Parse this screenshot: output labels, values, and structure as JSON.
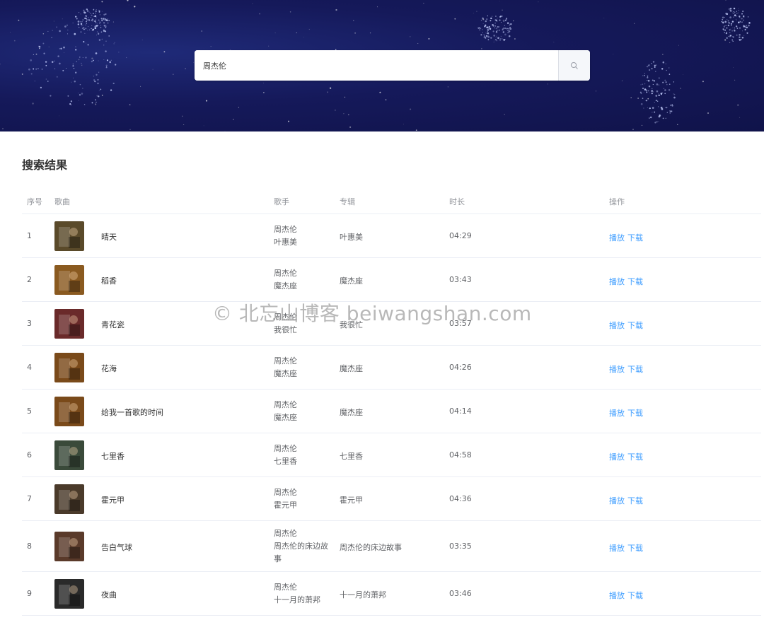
{
  "search": {
    "value": "周杰伦",
    "placeholder": ""
  },
  "section_title": "搜索结果",
  "columns": {
    "index": "序号",
    "song": "歌曲",
    "artist": "歌手",
    "album": "专辑",
    "duration": "时长",
    "actions": "操作"
  },
  "actions": {
    "play": "播放",
    "download": "下载"
  },
  "rows": [
    {
      "index": "1",
      "song": "晴天",
      "artist_line1": "周杰伦",
      "artist_line2": "叶惠美",
      "artist_line3": "",
      "album": "叶惠美",
      "duration": "04:29"
    },
    {
      "index": "2",
      "song": "稻香",
      "artist_line1": "周杰伦",
      "artist_line2": "魔杰座",
      "artist_line3": "",
      "album": "魔杰座",
      "duration": "03:43"
    },
    {
      "index": "3",
      "song": "青花瓷",
      "artist_line1": "周杰伦",
      "artist_line2": "我很忙",
      "artist_line3": "",
      "album": "我很忙",
      "duration": "03:57"
    },
    {
      "index": "4",
      "song": "花海",
      "artist_line1": "周杰伦",
      "artist_line2": "魔杰座",
      "artist_line3": "",
      "album": "魔杰座",
      "duration": "04:26"
    },
    {
      "index": "5",
      "song": "给我一首歌的时间",
      "artist_line1": "周杰伦",
      "artist_line2": "魔杰座",
      "artist_line3": "",
      "album": "魔杰座",
      "duration": "04:14"
    },
    {
      "index": "6",
      "song": "七里香",
      "artist_line1": "周杰伦",
      "artist_line2": "七里香",
      "artist_line3": "",
      "album": "七里香",
      "duration": "04:58"
    },
    {
      "index": "7",
      "song": "霍元甲",
      "artist_line1": "周杰伦",
      "artist_line2": "霍元甲",
      "artist_line3": "",
      "album": "霍元甲",
      "duration": "04:36"
    },
    {
      "index": "8",
      "song": "告白气球",
      "artist_line1": "周杰伦",
      "artist_line2": "周杰伦的床边故",
      "artist_line3": "事",
      "album": "周杰伦的床边故事",
      "duration": "03:35"
    },
    {
      "index": "9",
      "song": "夜曲",
      "artist_line1": "周杰伦",
      "artist_line2": "十一月的萧邦",
      "artist_line3": "",
      "album": "十一月的萧邦",
      "duration": "03:46"
    }
  ],
  "cover_colors": [
    "#5a4a2a",
    "#8a5a20",
    "#6a2a2a",
    "#7a4a1a",
    "#7a4a1a",
    "#3a4a3a",
    "#4a3a2a",
    "#5a3a2a",
    "#2a2a2a"
  ],
  "watermark": "© 北忘山博客 beiwangshan.com",
  "colors": {
    "header_bg": "#15195a",
    "link": "#409eff"
  }
}
